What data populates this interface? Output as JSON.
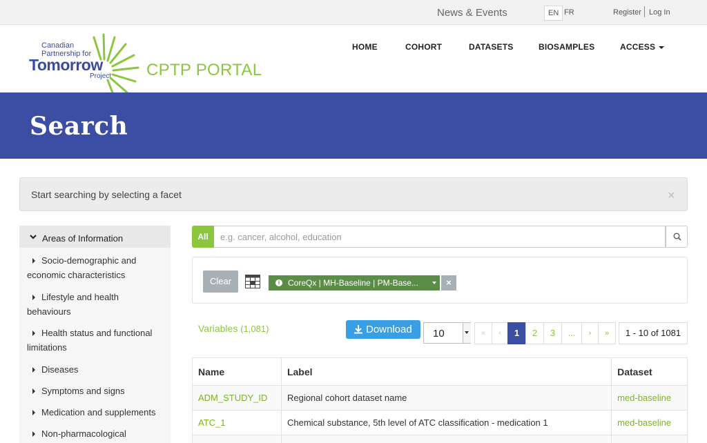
{
  "topbar": {
    "news_events": "News & Events",
    "lang_en": "EN",
    "lang_fr": "FR",
    "register": "Register",
    "login": "Log In"
  },
  "logo": {
    "line1": "Canadian",
    "line2": "Partnership for",
    "line3": "Tomorrow",
    "line4": "Project",
    "portal": "CPTP PORTAL"
  },
  "nav": {
    "home": "HOME",
    "cohort": "COHORT",
    "datasets": "DATASETS",
    "biosamples": "BIOSAMPLES",
    "access": "ACCESS"
  },
  "banner": {
    "title": "Search"
  },
  "alert": {
    "message": "Start searching by selecting a facet",
    "close": "×"
  },
  "sidebar": {
    "header": "Areas of Information",
    "items": [
      {
        "label": "Socio-demographic and economic characteristics"
      },
      {
        "label": "Lifestyle and health behaviours"
      },
      {
        "label": "Health status and functional limitations"
      },
      {
        "label": "Diseases"
      },
      {
        "label": "Symptoms and signs"
      },
      {
        "label": "Medication and supplements"
      },
      {
        "label": "Non-pharmacological"
      }
    ]
  },
  "search": {
    "all_label": "All",
    "placeholder": "e.g. cancer, alcohol, education"
  },
  "facets": {
    "clear_label": "Clear",
    "chip_text": "CoreQx | MH-Baseline | PM-Base...",
    "chip_remove": "×"
  },
  "results": {
    "variables_label": "Variables",
    "variables_count": "(1,081)",
    "download_label": "Download",
    "page_size": "10",
    "pager": {
      "first": "«",
      "prev": "‹",
      "p1": "1",
      "p2": "2",
      "p3": "3",
      "ellipsis": "...",
      "next": "›",
      "last": "»"
    },
    "range": "1 - 10 of 1081"
  },
  "table": {
    "headers": {
      "name": "Name",
      "label": "Label",
      "dataset": "Dataset"
    },
    "rows": [
      {
        "name": "ADM_STUDY_ID",
        "label": "Regional cohort dataset name",
        "dataset": "med-baseline"
      },
      {
        "name": "ATC_1",
        "label": "Chemical substance, 5th level of ATC classification - medication 1",
        "dataset": "med-baseline"
      }
    ]
  },
  "colors": {
    "brand_blue": "#3b4ea3",
    "brand_green": "#8cc63f",
    "chip_green": "#5c8d48",
    "download_blue": "#3a9ee4"
  },
  "icons": [
    "search-icon",
    "download-icon",
    "table-icon",
    "info-icon",
    "chevron-down-icon",
    "caret-right-icon",
    "close-icon"
  ]
}
